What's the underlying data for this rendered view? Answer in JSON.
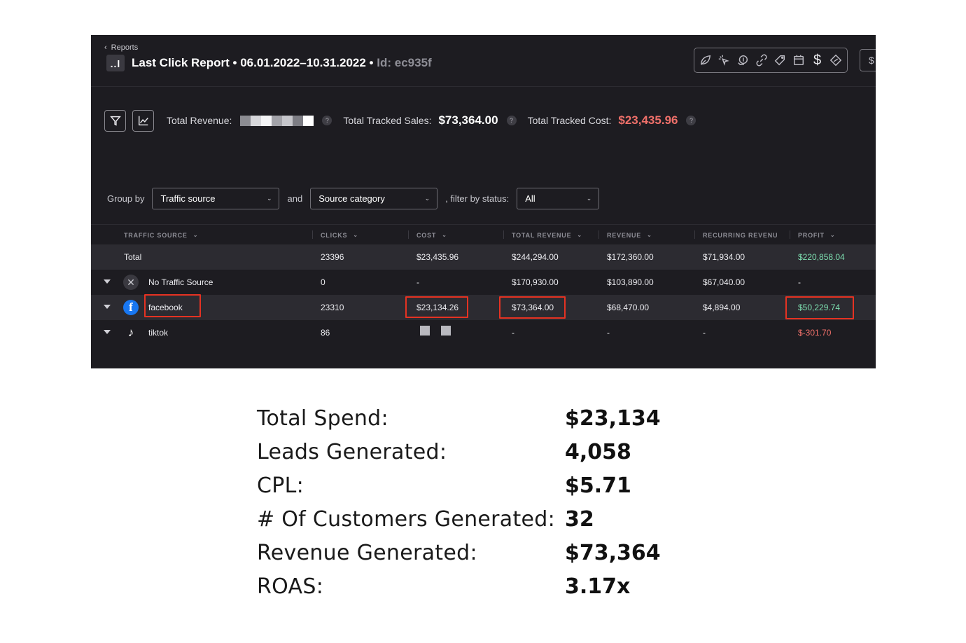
{
  "header": {
    "breadcrumb": "Reports",
    "logo_text": "..l",
    "title_prefix": "Last Click Report • 06.01.2022–10.31.2022 •",
    "id_label": "Id:",
    "id_value": "ec935f",
    "tools": [
      "leaf-icon",
      "pointer-click-icon",
      "coin-hand-icon",
      "link-icon",
      "tag-icon",
      "calendar-icon",
      "dollar-icon",
      "discount-tag-icon"
    ],
    "dollar_tool": "$",
    "edge_button": "$"
  },
  "summary": {
    "total_revenue_label": "Total Revenue:",
    "total_tracked_sales_label": "Total Tracked Sales:",
    "total_tracked_sales_value": "$73,364.00",
    "total_tracked_cost_label": "Total Tracked Cost:",
    "total_tracked_cost_value": "$23,435.96",
    "help": "?"
  },
  "filters": {
    "group_by_label": "Group by",
    "group_by_value": "Traffic source",
    "and_label": "and",
    "second_group_value": "Source category",
    "filter_label": ", filter by status:",
    "status_value": "All"
  },
  "table": {
    "columns": [
      "TRAFFIC SOURCE",
      "CLICKS",
      "COST",
      "TOTAL REVENUE",
      "REVENUE",
      "RECURRING REVENUE",
      "PROFIT"
    ],
    "total_row": {
      "name": "Total",
      "clicks": "23396",
      "cost": "$23,435.96",
      "total_revenue": "$244,294.00",
      "revenue": "$172,360.00",
      "recurring": "$71,934.00",
      "profit": "$220,858.04"
    },
    "rows": [
      {
        "name": "No Traffic Source",
        "clicks": "0",
        "cost": "-",
        "total_revenue": "$170,930.00",
        "revenue": "$103,890.00",
        "recurring": "$67,040.00",
        "profit": "-",
        "icon": "x-icon"
      },
      {
        "name": "facebook",
        "clicks": "23310",
        "cost": "$23,134.26",
        "total_revenue": "$73,364.00",
        "revenue": "$68,470.00",
        "recurring": "$4,894.00",
        "profit": "$50,229.74",
        "icon": "facebook-icon"
      },
      {
        "name": "tiktok",
        "clicks": "86",
        "cost": "",
        "total_revenue": "-",
        "revenue": "-",
        "recurring": "-",
        "profit": "$-301.70",
        "icon": "tiktok-icon"
      }
    ]
  },
  "stats": [
    {
      "label": "Total Spend:",
      "value": "$23,134"
    },
    {
      "label": "Leads Generated:",
      "value": "4,058"
    },
    {
      "label": "CPL:",
      "value": "$5.71"
    },
    {
      "label": "# Of Customers Generated:",
      "value": "32"
    },
    {
      "label": "Revenue Generated:",
      "value": "$73,364"
    },
    {
      "label": "ROAS:",
      "value": "3.17x"
    }
  ],
  "colors": {
    "panel_bg": "#1d1c21",
    "highlight": "#e53222",
    "profit_green": "#7ee0b1",
    "cost_red": "#f0706a",
    "facebook_blue": "#1877f2"
  }
}
